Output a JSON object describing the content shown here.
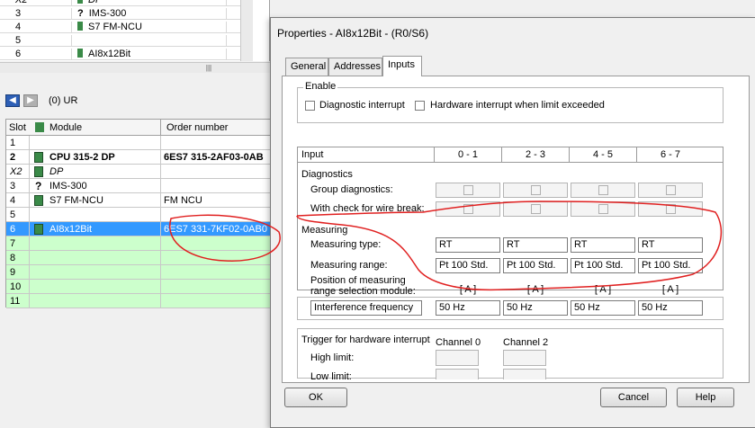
{
  "bg_list": {
    "rows": [
      {
        "slot": "X2",
        "module": "DP"
      },
      {
        "slot": "3",
        "module": "IMS-300"
      },
      {
        "slot": "4",
        "module": "S7 FM-NCU"
      },
      {
        "slot": "5",
        "module": ""
      },
      {
        "slot": "6",
        "module": "AI8x12Bit"
      }
    ]
  },
  "rack": {
    "label": "(0)  UR",
    "headers": {
      "slot": "Slot",
      "module": "Module",
      "order": "Order number"
    },
    "rows": [
      {
        "slot": "1",
        "module": "",
        "order": ""
      },
      {
        "slot": "2",
        "module": "CPU 315-2 DP",
        "order": "6ES7 315-2AF03-0AB"
      },
      {
        "slot": "X2",
        "module": "DP",
        "order": ""
      },
      {
        "slot": "3",
        "module": "IMS-300",
        "order": ""
      },
      {
        "slot": "4",
        "module": "S7 FM-NCU",
        "order": "FM NCU"
      },
      {
        "slot": "5",
        "module": "",
        "order": ""
      },
      {
        "slot": "6",
        "module": "AI8x12Bit",
        "order": "6ES7 331-7KF02-0AB0"
      },
      {
        "slot": "7",
        "module": "",
        "order": ""
      },
      {
        "slot": "8",
        "module": "",
        "order": ""
      },
      {
        "slot": "9",
        "module": "",
        "order": ""
      },
      {
        "slot": "10",
        "module": "",
        "order": ""
      },
      {
        "slot": "11",
        "module": "",
        "order": ""
      }
    ]
  },
  "dialog": {
    "title": "Properties - AI8x12Bit - (R0/S6)",
    "tabs": [
      "General",
      "Addresses",
      "Inputs"
    ],
    "enable_group": "Enable",
    "diag_interrupt": "Diagnostic interrupt",
    "hw_interrupt": "Hardware interrupt when limit exceeded",
    "grid": {
      "input_label": "Input",
      "channels": [
        "0 - 1",
        "2 - 3",
        "4 - 5",
        "6 - 7"
      ],
      "diagnostics": "Diagnostics",
      "group_diag": "Group diagnostics:",
      "wire_break": "With check for wire break:",
      "measuring": "Measuring",
      "type_label": "Measuring type:",
      "types": [
        "RT",
        "RT",
        "RT",
        "RT"
      ],
      "range_label": "Measuring range:",
      "ranges": [
        "Pt 100 Std.",
        "Pt 100 Std.",
        "Pt 100 Std.",
        "Pt 100 Std."
      ],
      "position_label_1": "Position of measuring",
      "position_label_2": "range selection module:",
      "positions": [
        "[ A ]",
        "[ A ]",
        "[ A ]",
        "[ A ]"
      ]
    },
    "interference_label": "Interference frequency",
    "frequencies": [
      "50 Hz",
      "50 Hz",
      "50 Hz",
      "50 Hz"
    ],
    "trigger": {
      "label": "Trigger for hardware interrupt",
      "channel0": "Channel 0",
      "channel2": "Channel 2",
      "high": "High limit:",
      "low": "Low limit:"
    },
    "buttons": {
      "ok": "OK",
      "cancel": "Cancel",
      "help": "Help"
    }
  },
  "colors": {
    "selection": "#3399ff",
    "empty_slot": "#ccffcc",
    "annotation": "#e02020"
  }
}
